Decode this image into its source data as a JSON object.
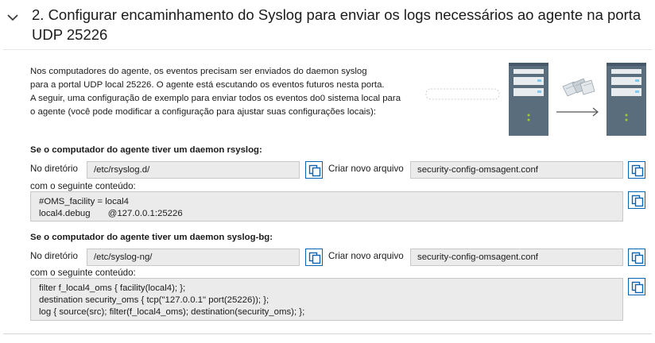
{
  "header": {
    "title": "2. Configurar encaminhamento do Syslog para enviar os logs necessários ao agente na porta UDP 25226"
  },
  "intro": {
    "lines": [
      "Nos computadores do agente, os eventos precisam ser enviados do daemon syslog",
      "para a portal UDP local 25226. O agente está escutando os eventos futuros nesta porta.",
      "A seguir, uma configuração de exemplo para enviar todos os eventos do0 sistema local para",
      "o agente (você pode modificar a configuração para ajustar suas configurações locais):"
    ]
  },
  "rsyslog": {
    "heading": "Se o computador do agente tiver um daemon rsyslog:",
    "dir_label": "No diretório",
    "dir_value": "/etc/rsyslog.d/",
    "file_label": "Criar novo arquivo",
    "file_value": "security-config-omsagent.conf",
    "content_label": "com o seguinte conteúdo:",
    "content": "#OMS_facility = local4\nlocal4.debug       @127.0.0.1:25226"
  },
  "syslogng": {
    "heading": "Se o computador do agente tiver um daemon syslog-bg:",
    "dir_label": "No diretório",
    "dir_value": "/etc/syslog-ng/",
    "file_label": "Criar novo arquivo",
    "file_value": "security-config-omsagent.conf",
    "content_label": "com o seguinte conteúdo:",
    "content": "filter f_local4_oms { facility(local4); };\ndestination security_oms { tcp(\"127.0.0.1\" port(25226)); };\nlog { source(src); filter(f_local4_oms); destination(security_oms); };"
  },
  "icons": {
    "expand": "chevron-down-icon",
    "copy": "copy-icon",
    "server": "server-icon",
    "documents": "documents-icon",
    "arrow": "arrow-right-icon"
  },
  "colors": {
    "accent": "#0a64b4",
    "field_bg": "#ebebeb",
    "server_body": "#5a6d7c"
  }
}
